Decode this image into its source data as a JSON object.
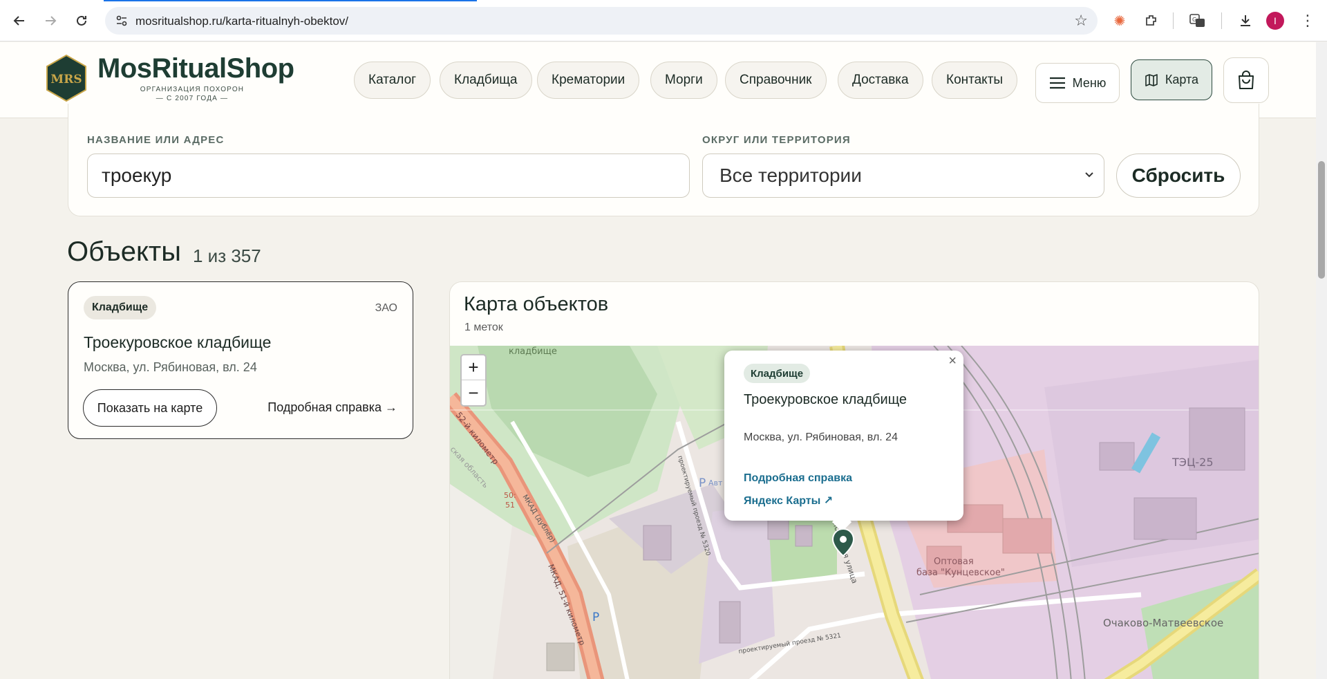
{
  "browser": {
    "url": "mosritualshop.ru/karta-ritualnyh-obektov/"
  },
  "profile_initial": "I",
  "header": {
    "brand": "MosRitualShop",
    "tagline_1": "ОРГАНИЗАЦИЯ ПОХОРОН",
    "tagline_2": "— С 2007 ГОДА —",
    "logo_letters": "MRS",
    "nav": [
      "Каталог",
      "Кладбища",
      "Крематории",
      "Морги",
      "Справочник",
      "Доставка",
      "Контакты"
    ],
    "menu_label": "Меню",
    "map_label": "Карта"
  },
  "filters": {
    "name_label": "НАЗВАНИЕ ИЛИ АДРЕС",
    "name_value": "троекур",
    "district_label": "ОКРУГ ИЛИ ТЕРРИТОРИЯ",
    "district_value": "Все территории",
    "reset_label": "Сбросить"
  },
  "objects": {
    "title": "Объекты",
    "count": "1 из 357"
  },
  "result": {
    "badge": "Кладбище",
    "district": "ЗАО",
    "name": "Троекуровское кладбище",
    "address": "Москва, ул. Рябиновая, вл. 24",
    "show_on_map": "Показать на карте",
    "details": "Подробная справка →"
  },
  "map": {
    "title": "Карта объектов",
    "subtitle": "1 меток",
    "zoom_in": "+",
    "zoom_out": "−",
    "popup": {
      "badge": "Кладбище",
      "name": "Троекуровское кладбище",
      "address": "Москва, ул. Рябиновая, вл. 24",
      "details_link": "Подробная справка",
      "yandex_link": "Яндекс Карты ↗",
      "close": "×"
    },
    "labels": {
      "cemetery": "кладбище",
      "mkad_km": "52-й километр",
      "region": "ская область",
      "km_marker_1": "50:",
      "km_marker_2": "51",
      "mkad_dubler": "МКАД (дублёр)",
      "mkad_51": "МКАД, 51-й километр",
      "proezd_5320": "проектируемый проезд № 5320",
      "proezd_5321": "проектируемый проезд № 5321",
      "street": "Рябиновая улица",
      "tec": "ТЭЦ-25",
      "base_1": "Оптовая",
      "base_2": "база \"Кунцевское\"",
      "district": "Очаково-Матвеевское",
      "parking": "P",
      "avt": "Авт"
    }
  }
}
